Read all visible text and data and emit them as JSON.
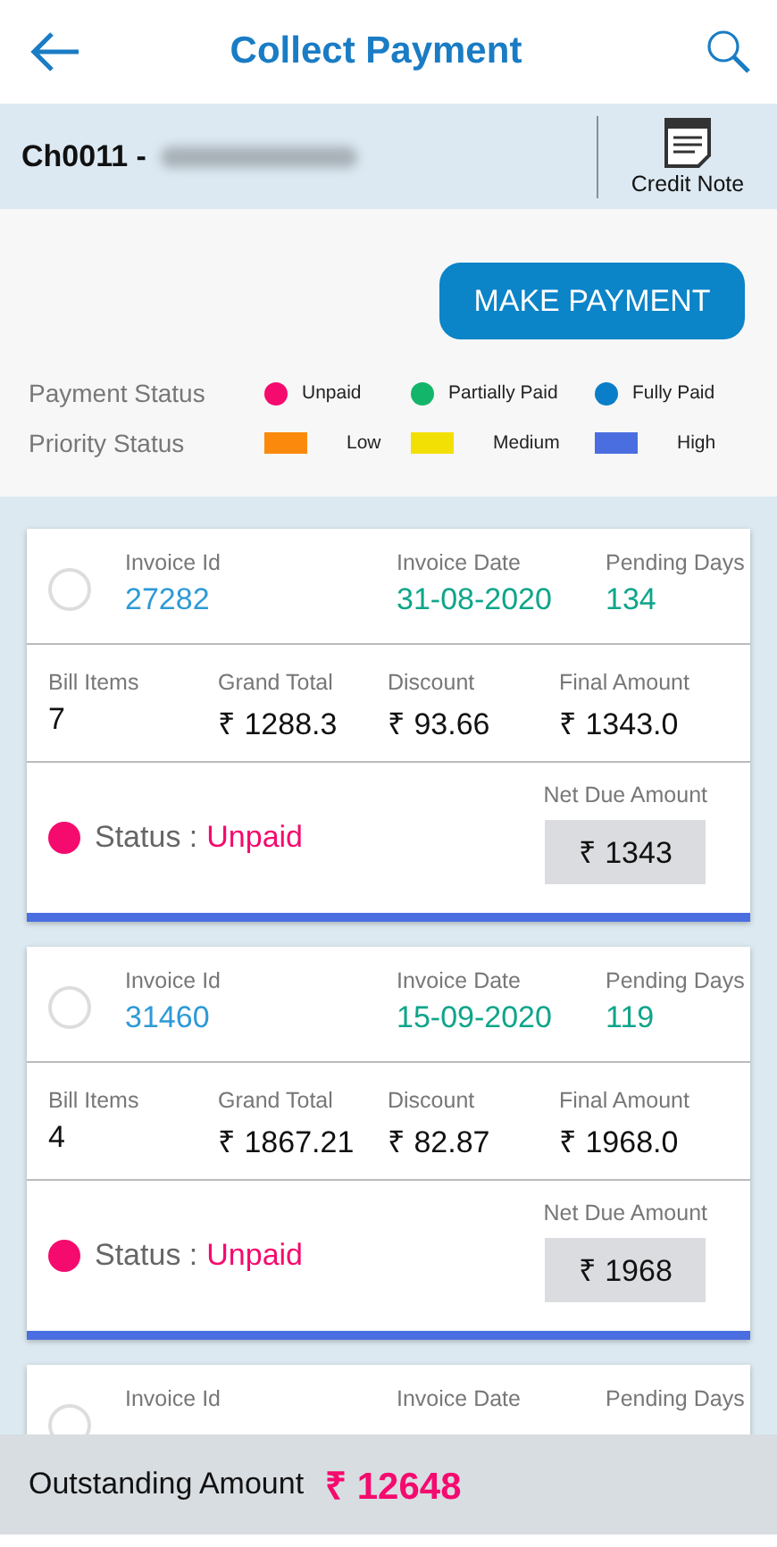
{
  "header": {
    "title": "Collect Payment"
  },
  "customer": {
    "code": "Ch0011 -",
    "credit_note_label": "Credit Note"
  },
  "make_payment_button": "MAKE PAYMENT",
  "legend": {
    "payment_label": "Payment Status",
    "payment_items": [
      {
        "label": "Unpaid",
        "color": "#f50a6e"
      },
      {
        "label": "Partially Paid",
        "color": "#12b56a"
      },
      {
        "label": "Fully Paid",
        "color": "#0a7ec8"
      }
    ],
    "priority_label": "Priority Status",
    "priority_items": [
      {
        "label": "Low",
        "color": "#fb8a0c"
      },
      {
        "label": "Medium",
        "color": "#f2e004"
      },
      {
        "label": "High",
        "color": "#4a6ee0"
      }
    ]
  },
  "invoices": [
    {
      "selected": false,
      "invoice_id_label": "Invoice Id",
      "invoice_id": "27282",
      "invoice_date_label": "Invoice Date",
      "invoice_date": "31-08-2020",
      "pending_days_label": "Pending Days",
      "pending_days": "134",
      "bill_items_label": "Bill Items",
      "bill_items": "7",
      "grand_total_label": "Grand Total",
      "grand_total": "₹ 1288.3",
      "discount_label": "Discount",
      "discount": "₹ 93.66",
      "final_amount_label": "Final Amount",
      "final_amount": "₹ 1343.0",
      "status_label": "Status :",
      "status": {
        "label": "Unpaid",
        "color": "#f50a6e"
      },
      "net_due_label": "Net Due Amount",
      "net_due": "₹ 1343",
      "priority": {
        "color": "#4a6ee0"
      }
    },
    {
      "selected": false,
      "invoice_id_label": "Invoice Id",
      "invoice_id": "31460",
      "invoice_date_label": "Invoice Date",
      "invoice_date": "15-09-2020",
      "pending_days_label": "Pending Days",
      "pending_days": "119",
      "bill_items_label": "Bill Items",
      "bill_items": "4",
      "grand_total_label": "Grand Total",
      "grand_total": "₹ 1867.21",
      "discount_label": "Discount",
      "discount": "₹ 82.87",
      "final_amount_label": "Final Amount",
      "final_amount": "₹ 1968.0",
      "status_label": "Status :",
      "status": {
        "label": "Unpaid",
        "color": "#f50a6e"
      },
      "net_due_label": "Net Due Amount",
      "net_due": "₹ 1968",
      "priority": {
        "color": "#4a6ee0"
      }
    },
    {
      "selected": false,
      "invoice_id_label": "Invoice Id",
      "invoice_date_label": "Invoice Date",
      "pending_days_label": "Pending Days"
    }
  ],
  "footer": {
    "label": "Outstanding Amount",
    "amount": "₹ 12648"
  }
}
